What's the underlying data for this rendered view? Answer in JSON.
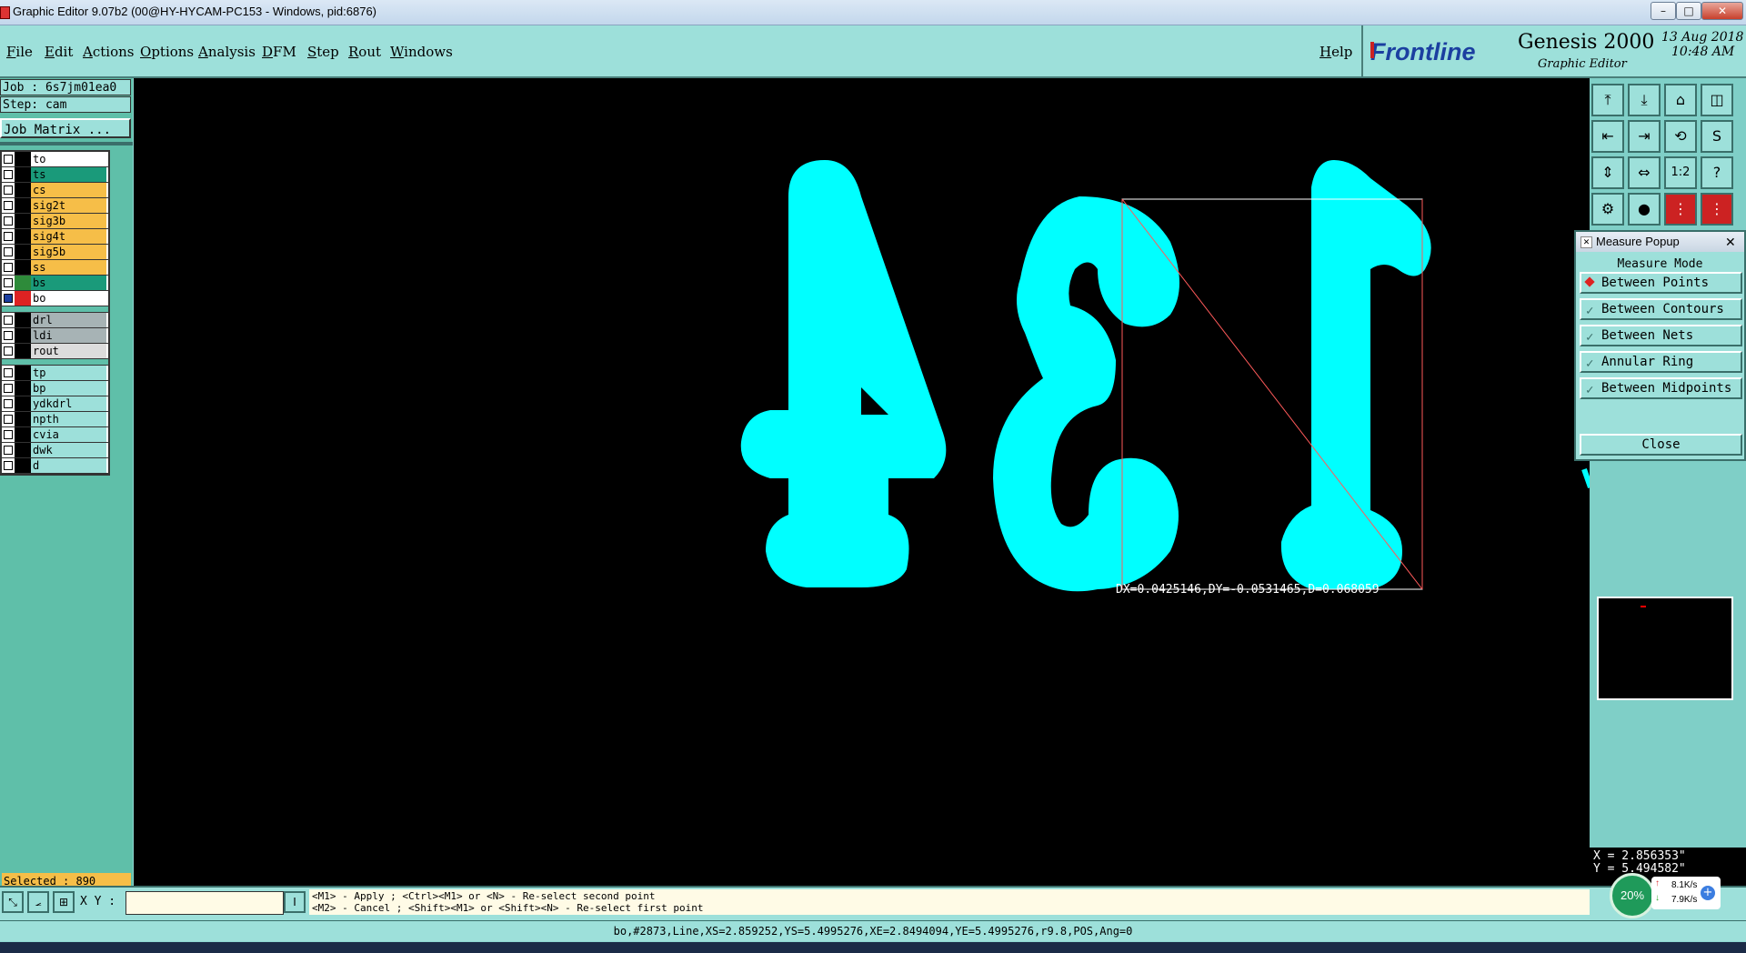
{
  "window": {
    "title": "Graphic Editor 9.07b2 (00@HY-HYCAM-PC153 - Windows, pid:6876)",
    "minimize": "–",
    "maximize": "□",
    "close": "✕"
  },
  "menu": {
    "items": [
      "File",
      "Edit",
      "Actions",
      "Options",
      "Analysis",
      "DFM",
      "Step",
      "Rout",
      "Windows"
    ],
    "help": "Help"
  },
  "brand": {
    "logo": "Frontline",
    "product": "Genesis 2000",
    "subtitle": "Graphic Editor",
    "date": "13 Aug 2018",
    "time": "10:48 AM"
  },
  "job": {
    "job_line": "Job : 6s7jm01ea0",
    "step_line": "Step: cam",
    "matrix_button": "Job Matrix ..."
  },
  "layers": {
    "group1": [
      {
        "name": "to",
        "color": "#ffffff"
      },
      {
        "name": "ts",
        "color": "#1a9a7a"
      },
      {
        "name": "cs",
        "color": "#f6be48"
      },
      {
        "name": "sig2t",
        "color": "#f6be48"
      },
      {
        "name": "sig3b",
        "color": "#f6be48"
      },
      {
        "name": "sig4t",
        "color": "#f6be48"
      },
      {
        "name": "sig5b",
        "color": "#f6be48"
      },
      {
        "name": "ss",
        "color": "#f6be48"
      },
      {
        "name": "bs",
        "color": "#1a9a7a"
      },
      {
        "name": "bo",
        "color": "#ffffff"
      }
    ],
    "group2": [
      {
        "name": "drl",
        "color": "#a7b3b5"
      },
      {
        "name": "ldi",
        "color": "#a7b3b5"
      },
      {
        "name": "rout",
        "color": "#dcdcdc"
      }
    ],
    "group3": [
      {
        "name": "tp",
        "color": "#9de0da"
      },
      {
        "name": "bp",
        "color": "#9de0da"
      },
      {
        "name": "ydkdrl",
        "color": "#9de0da"
      },
      {
        "name": "npth",
        "color": "#9de0da"
      },
      {
        "name": "cvia",
        "color": "#9de0da"
      },
      {
        "name": "dwk",
        "color": "#9de0da"
      },
      {
        "name": "d",
        "color": "#9de0da"
      }
    ]
  },
  "canvas": {
    "measure_readout": "DX=0.0425146,DY=-0.0531465,D=0.068059",
    "feature_color": "#00ffff"
  },
  "measure_popup": {
    "title": "Measure Popup",
    "mode_label": "Measure Mode",
    "options": [
      "Between Points",
      "Between Contours",
      "Between Nets",
      "Annular Ring",
      "Between Midpoints"
    ],
    "selected": "Between Points",
    "close_label": "Close"
  },
  "selected_count": "Selected : 890",
  "coords": {
    "x": "X = 2.856353\"",
    "y": "Y = 5.494582\""
  },
  "bottom": {
    "xy_label": "X Y :",
    "xy_value": "",
    "hint1": "<M1> - Apply  ; <Ctrl><M1> or <N> - Re-select second point",
    "hint2": "<M2> - Cancel ; <Shift><M1> or <Shift><N> - Re-select first point"
  },
  "status": "bo,#2873,Line,XS=2.859252,YS=5.4995276,XE=2.8494094,YE=5.4995276,r9.8,POS,Ang=0",
  "network": {
    "percent": "20%",
    "up": "8.1K/s",
    "down": "7.9K/s"
  }
}
